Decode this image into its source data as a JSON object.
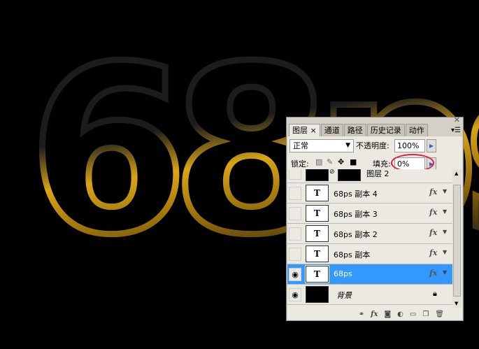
{
  "canvas": {
    "art_text": "68ps",
    "stroke_color": "#1c1c1c",
    "highlight_color": "#d9a516"
  },
  "panel": {
    "tabs": [
      {
        "label": "图层",
        "active": true
      },
      {
        "label": "通道"
      },
      {
        "label": "路径"
      },
      {
        "label": "历史记录"
      },
      {
        "label": "动作"
      }
    ],
    "blend_mode": "正常",
    "opacity_label": "不透明度:",
    "opacity_value": "100%",
    "lock_label": "锁定:",
    "fill_label": "填充:",
    "fill_value": "0%",
    "fill_highlight_color": "#e0203a",
    "layers": [
      {
        "name": "图层 2",
        "visible": false,
        "type": "image"
      },
      {
        "name": "68ps  副本 4",
        "visible": false,
        "type": "text",
        "fx": "fx"
      },
      {
        "name": "68ps  副本 3",
        "visible": false,
        "type": "text",
        "fx": "fx"
      },
      {
        "name": "68ps  副本 2",
        "visible": false,
        "type": "text",
        "fx": "fx"
      },
      {
        "name": "68ps  副本",
        "visible": false,
        "type": "text",
        "fx": "fx"
      },
      {
        "name": "68ps",
        "visible": true,
        "type": "text",
        "fx": "fx",
        "selected": true
      },
      {
        "name": "背景",
        "visible": true,
        "type": "background",
        "locked": true
      }
    ],
    "thumb_text": "T",
    "selected_color": "#3399ff"
  }
}
